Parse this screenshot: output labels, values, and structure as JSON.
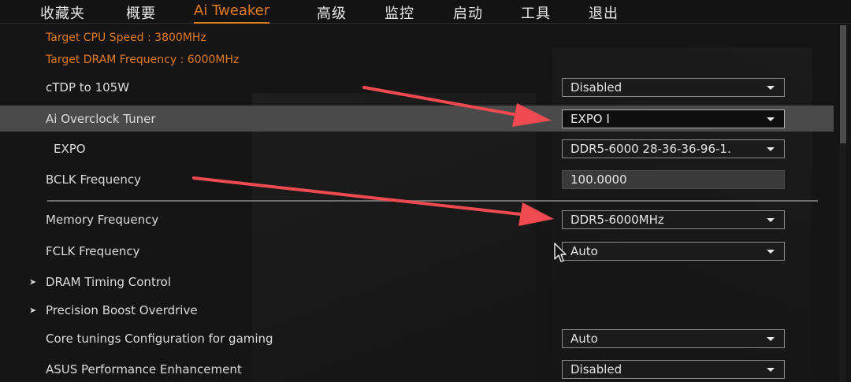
{
  "tabs": [
    {
      "label": "收藏夹",
      "active": false
    },
    {
      "label": "概要",
      "active": false
    },
    {
      "label": "Ai Tweaker",
      "active": true
    },
    {
      "label": "高级",
      "active": false
    },
    {
      "label": "监控",
      "active": false
    },
    {
      "label": "启动",
      "active": false
    },
    {
      "label": "工具",
      "active": false
    },
    {
      "label": "退出",
      "active": false
    }
  ],
  "info": {
    "target_cpu_speed": "Target CPU Speed : 3800MHz",
    "target_dram_frequency": "Target DRAM Frequency : 6000MHz"
  },
  "settings": {
    "ctdp": {
      "label": "cTDP to 105W",
      "value": "Disabled"
    },
    "ai_overclock_tuner": {
      "label": "Ai Overclock Tuner",
      "value": "EXPO I"
    },
    "expo": {
      "label": "EXPO",
      "value": "DDR5-6000 28-36-36-96-1."
    },
    "bclk_frequency": {
      "label": "BCLK Frequency",
      "value": "100.0000"
    },
    "memory_frequency": {
      "label": "Memory Frequency",
      "value": "DDR5-6000MHz"
    },
    "fclk_frequency": {
      "label": "FCLK Frequency",
      "value": "Auto"
    },
    "dram_timing_control": {
      "label": "DRAM Timing Control",
      "marker": "➤"
    },
    "precision_boost_overdrive": {
      "label": "Precision Boost Overdrive",
      "marker": "➤"
    },
    "core_tunings": {
      "label": "Core tunings Configuration for gaming",
      "value": "Auto"
    },
    "asus_pe": {
      "label": "ASUS Performance Enhancement",
      "value": "Disabled"
    }
  },
  "colors": {
    "accent": "#e07a21",
    "annotation_arrow": "#ee4a4f",
    "selected_row": "#4a4a4a",
    "background": "#151515"
  },
  "icons": {
    "dropdown": "caret-down-icon",
    "submenu": "right-arrow-icon",
    "cursor": "mouse-pointer-icon"
  }
}
